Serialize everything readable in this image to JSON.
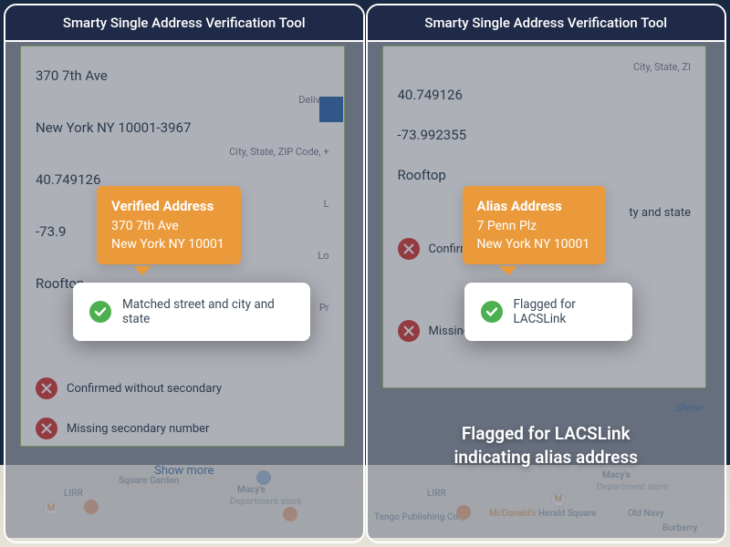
{
  "header": "Smarty Single Address Verification Tool",
  "left": {
    "addr1": "370 7th Ave",
    "sub1": "Deliver",
    "city": "New York NY 10001-3967",
    "sub2": "City, State, ZIP Code, +",
    "lat": "40.749126",
    "lng": "-73.9",
    "geo": "Rooftop",
    "showmore": "Show more",
    "callout_title": "Verified Address",
    "callout_l1": "370 7th Ave",
    "callout_l2": "New York NY 10001",
    "highlight": "Matched street and city and state",
    "status_confirm": "Confirmed without secondary",
    "status_missing": "Missing secondary number"
  },
  "right": {
    "sub0": "City, State, ZI",
    "lat": "40.749126",
    "lng": "-73.992355",
    "geo": "Rooftop",
    "callout_title": "Alias Address",
    "callout_l1": "7 Penn Plz",
    "callout_l2": "New York NY 10001",
    "status_match_tail": "ty and state",
    "status_confirm": "Confirmed without secondary",
    "highlight": "Flagged for LACSLink",
    "status_missing": "Missing secondary number",
    "show": "Show",
    "caption_l1": "Flagged for LACSLink",
    "caption_l2": "indicating alias address"
  },
  "map": {
    "macys": "Macy's",
    "dept": "Department store",
    "lirr": "LIRR",
    "sq": "Square Garden",
    "tango": "Tango Publishing Corp",
    "mcd": "McDonald's",
    "hf": "Herald Square",
    "old": "Old Navy",
    "burb": "Burberry"
  }
}
